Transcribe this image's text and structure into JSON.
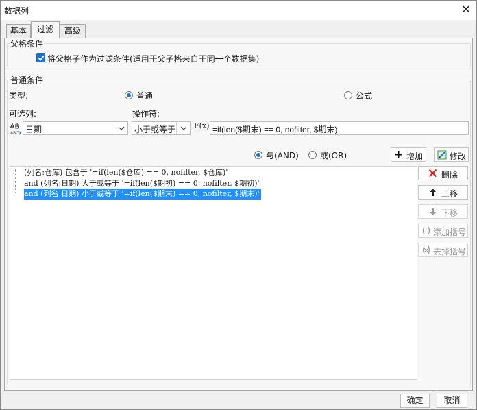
{
  "window": {
    "title": "数据列",
    "close_symbol": "✕"
  },
  "tabs": [
    {
      "label": "基本"
    },
    {
      "label": "过滤",
      "active": true
    },
    {
      "label": "高级"
    }
  ],
  "parent_condition": {
    "legend": "父格条件",
    "checkbox_label": "将父格子作为过滤条件(适用于父子格来自于同一个数据集)",
    "checked": true
  },
  "normal_condition": {
    "legend": "普通条件",
    "type_label": "类型:",
    "type_options": [
      {
        "label": "普通",
        "checked": true
      },
      {
        "label": "公式",
        "checked": false
      }
    ],
    "column_label": "可选列:",
    "operator_label": "操作符:",
    "column_value": "日期",
    "column_icon": "abc-column-icon",
    "operator_value": "小于或等于",
    "formula_icon_text": "F(x)",
    "formula_value": "=if(len($期末) == 0, nofilter, $期末)",
    "logic_options": [
      {
        "label": "与(AND)",
        "checked": true
      },
      {
        "label": "或(OR)",
        "checked": false
      }
    ],
    "add_label": "增加",
    "modify_label": "修改"
  },
  "conditions": [
    {
      "text": "(列名:仓库) 包含于 '=if(len($仓库) == 0, nofilter, $仓库)'",
      "selected": false
    },
    {
      "text": "and (列名:日期) 大于或等于 '=if(len($期初) == 0, nofilter, $期初)'",
      "selected": false
    },
    {
      "text": "and (列名:日期) 小于或等于 '=if(len($期末) == 0, nofilter, $期末)'",
      "selected": true
    }
  ],
  "side_buttons": [
    {
      "label": "删除",
      "icon": "delete-x-icon",
      "enabled": true,
      "color": "#e02424"
    },
    {
      "label": "上移",
      "icon": "arrow-up-icon",
      "enabled": true,
      "color": "#222222"
    },
    {
      "label": "下移",
      "icon": "arrow-down-icon",
      "enabled": false,
      "color": "#9a9a9a"
    },
    {
      "label": "添加括号",
      "icon": "add-brackets-icon",
      "enabled": false,
      "color": "#9a9a9a"
    },
    {
      "label": "去掉括号",
      "icon": "remove-brackets-icon",
      "enabled": false,
      "color": "#9a9a9a"
    }
  ],
  "footer": {
    "ok_label": "确定",
    "cancel_label": "取消"
  },
  "colors": {
    "accent": "#1a73d6",
    "selection": "#1e90ff",
    "delete": "#e02424"
  }
}
